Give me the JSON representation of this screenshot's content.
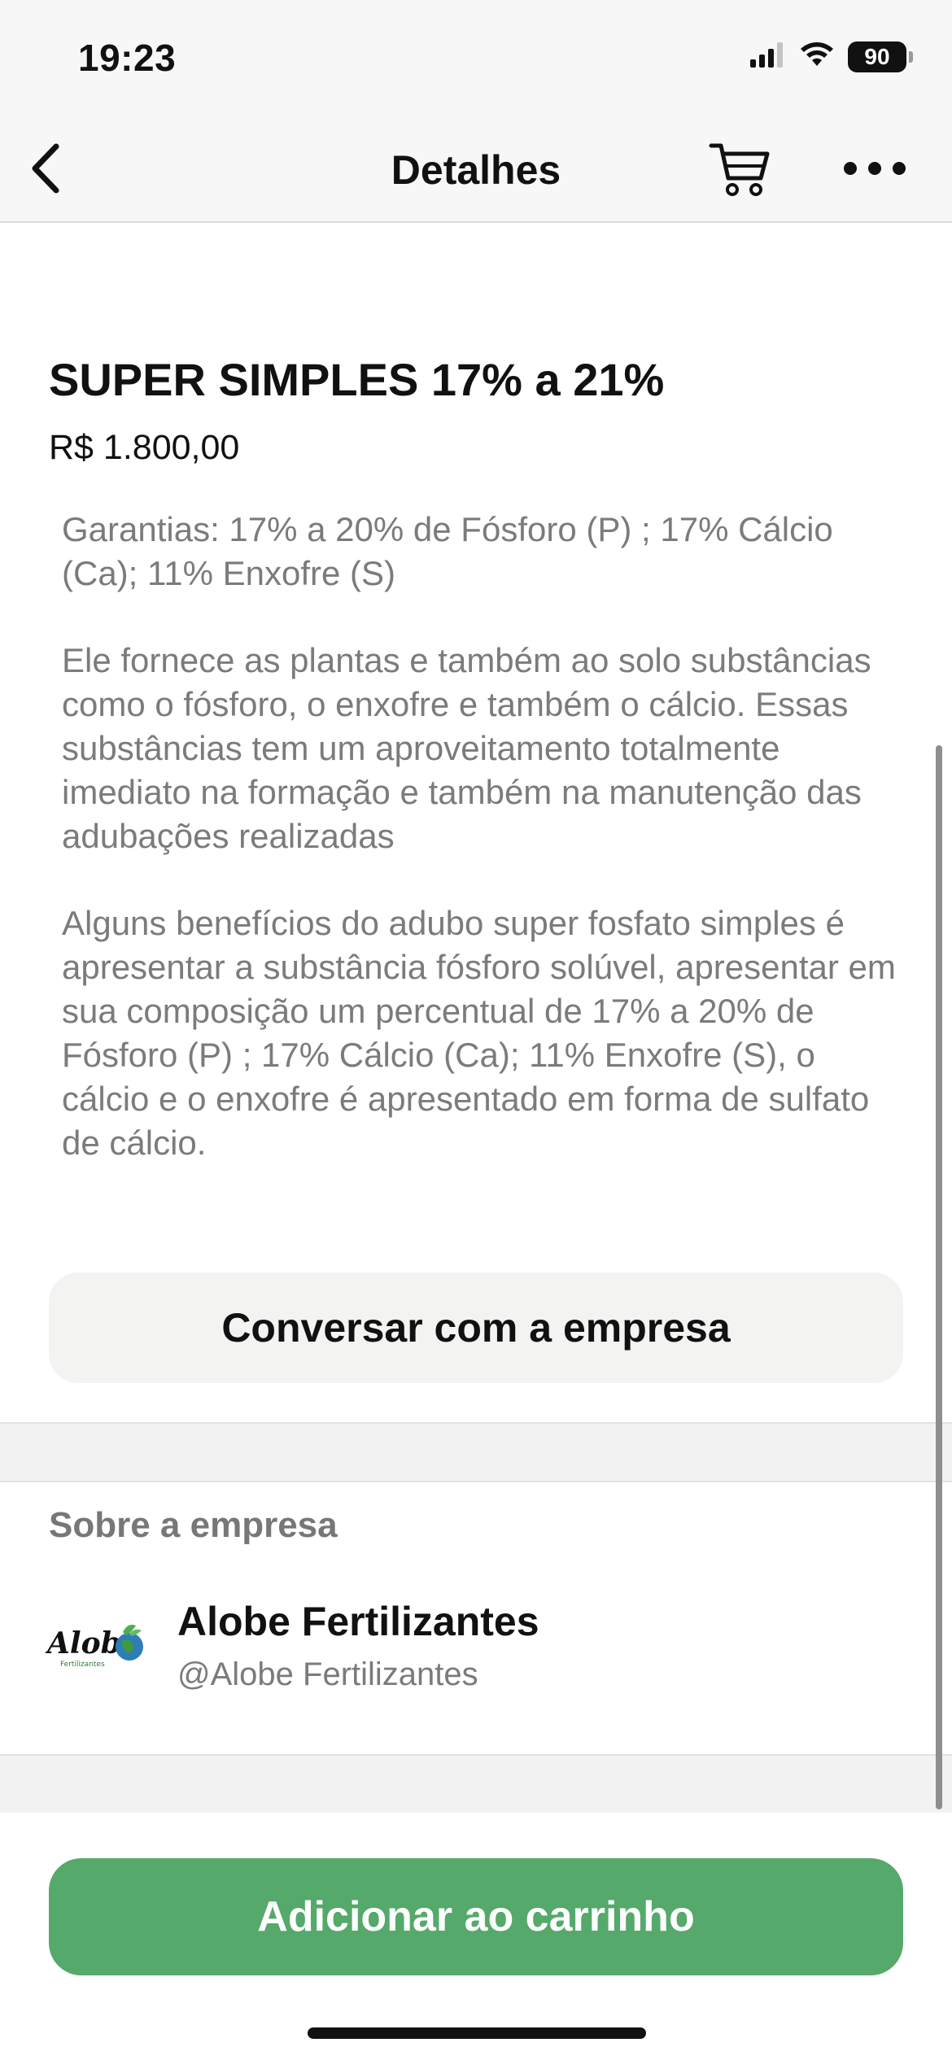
{
  "status_bar": {
    "time": "19:23",
    "battery": "90",
    "icons": [
      "cellular-signal-icon",
      "wifi-icon",
      "battery-icon"
    ]
  },
  "nav": {
    "title": "Detalhes",
    "icons": [
      "chevron-left-icon",
      "cart-icon",
      "more-dots-icon"
    ]
  },
  "product": {
    "title": "SUPER SIMPLES 17% a 21%",
    "price": "R$ 1.800,00",
    "description": [
      "Garantias: 17% a 20% de Fósforo (P) ; 17% Cálcio (Ca); 11% Enxofre (S)",
      "Ele fornece as plantas e também ao solo substâncias como o fósforo, o enxofre e também o cálcio. Essas substâncias tem um aproveitamento totalmente imediato na formação e também na manutenção das adubações realizadas",
      "Alguns benefícios do adubo super fosfato simples é apresentar a substância fósforo solúvel, apresentar em sua composição um percentual de 17% a 20% de Fósforo (P) ; 17% Cálcio (Ca); 11% Enxofre (S), o cálcio e o enxofre é apresentado em forma de sulfato de cálcio."
    ]
  },
  "chat_button_label": "Conversar com a empresa",
  "company": {
    "heading": "Sobre a empresa",
    "name": "Alobe Fertilizantes",
    "handle": "@Alobe Fertilizantes",
    "logo_text": "Alobe",
    "logo_subtext": "Fertilizantes"
  },
  "add_to_cart_label": "Adicionar ao carrinho",
  "colors": {
    "accent_green": "#55a96a",
    "nav_background": "#f7f7f7",
    "secondary_text": "#7b7b7b",
    "chat_button_bg": "#f3f3f2"
  }
}
